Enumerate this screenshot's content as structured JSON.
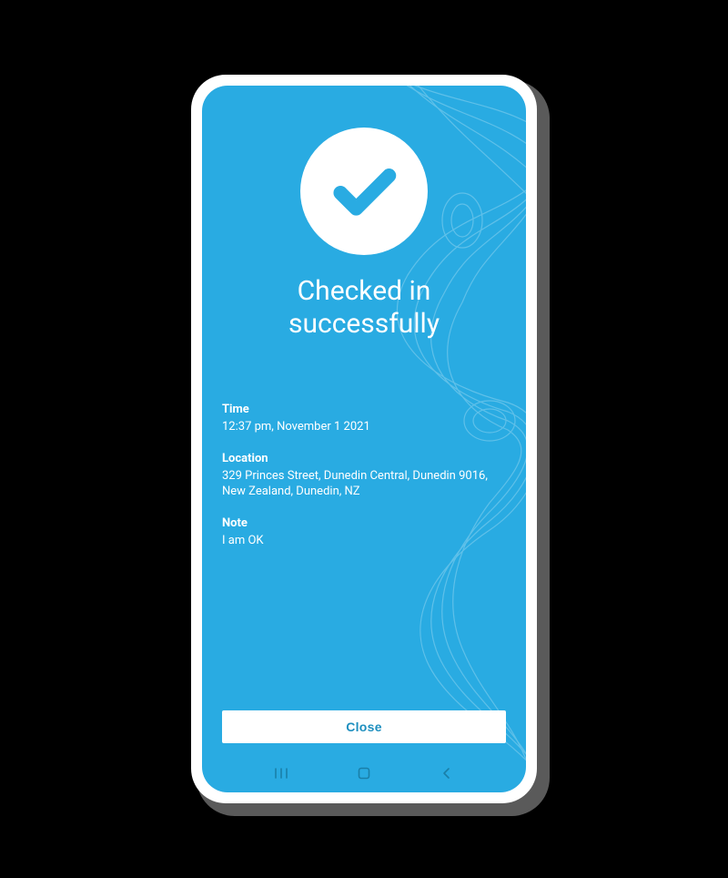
{
  "accent": "#29abe2",
  "hero": {
    "icon": "checkmark-circle",
    "title": "Checked in successfully"
  },
  "details": {
    "time": {
      "label": "Time",
      "value": "12:37 pm, November 1 2021"
    },
    "location": {
      "label": "Location",
      "value": "329 Princes Street, Dunedin Central, Dunedin 9016, New Zealand, Dunedin, NZ"
    },
    "note": {
      "label": "Note",
      "value": "I am OK"
    }
  },
  "actions": {
    "close_label": "Close"
  },
  "nav": {
    "recent": "recent-apps",
    "home": "home",
    "back": "back"
  }
}
